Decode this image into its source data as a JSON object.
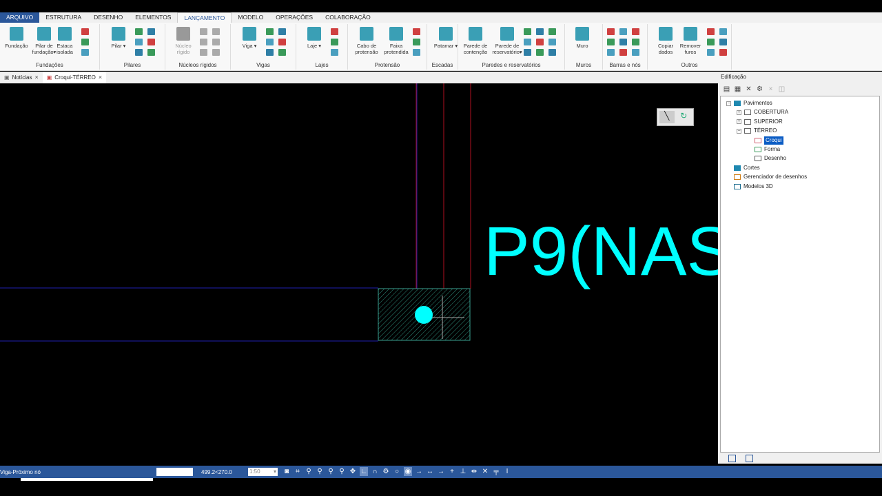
{
  "menu": {
    "tabs": [
      "ARQUIVO",
      "ESTRUTURA",
      "DESENHO",
      "ELEMENTOS",
      "LANÇAMENTO",
      "MODELO",
      "OPERAÇÕES",
      "COLABORAÇÃO"
    ],
    "active": "LANÇAMENTO"
  },
  "ribbon": {
    "groups": [
      {
        "title": "Fundações",
        "buttons": [
          "Fundação",
          "Pilar de fundação▾",
          "Estaca isolada"
        ]
      },
      {
        "title": "Pilares",
        "buttons": [
          "Pilar ▾"
        ]
      },
      {
        "title": "Núcleos rígidos",
        "buttons": [
          "Núcleo rígido"
        ]
      },
      {
        "title": "Vigas",
        "buttons": [
          "Viga ▾"
        ]
      },
      {
        "title": "Lajes",
        "buttons": [
          "Laje ▾"
        ]
      },
      {
        "title": "Protensão",
        "buttons": [
          "Cabo de protensão",
          "Faixa protendida"
        ]
      },
      {
        "title": "Escadas",
        "buttons": [
          "Patamar ▾"
        ]
      },
      {
        "title": "Paredes e reservatórios",
        "buttons": [
          "Parede de contenção",
          "Parede de reservatório▾"
        ]
      },
      {
        "title": "Muros",
        "buttons": [
          "Muro"
        ]
      },
      {
        "title": "Barras e nós",
        "buttons": []
      },
      {
        "title": "Outros",
        "buttons": [
          "Copiar dados",
          "Remover furos"
        ]
      }
    ]
  },
  "doc_tabs": [
    {
      "label": "Notícias",
      "active": false
    },
    {
      "label": "Croqui-TÉRREO",
      "active": true
    }
  ],
  "canvas": {
    "label": "P9(NAS",
    "colors": {
      "text": "#00ffff",
      "column": "#00ffff",
      "hatch": "#2e8b7a",
      "beam": "#1a1aa0",
      "axis": "#b01020"
    }
  },
  "panel": {
    "title": "Edificação",
    "tree": [
      {
        "label": "Pavimentos",
        "level": 0,
        "icon": "folder-icon",
        "expander": "−"
      },
      {
        "label": "COBERTURA",
        "level": 1,
        "icon": "floor-icon",
        "expander": "+"
      },
      {
        "label": "SUPERIOR",
        "level": 1,
        "icon": "floor-icon",
        "expander": "+"
      },
      {
        "label": "TÉRREO",
        "level": 1,
        "icon": "floor-icon",
        "expander": "−"
      },
      {
        "label": "Croqui",
        "level": 2,
        "icon": "sketch-icon",
        "selected": true
      },
      {
        "label": "Forma",
        "level": 2,
        "icon": "form-icon"
      },
      {
        "label": "Desenho",
        "level": 2,
        "icon": "drawing-icon"
      },
      {
        "label": "Cortes",
        "level": 0,
        "icon": "folder-icon"
      },
      {
        "label": "Gerenciador de desenhos",
        "level": 0,
        "icon": "drawing-manager-icon"
      },
      {
        "label": "Modelos 3D",
        "level": 0,
        "icon": "model-3d-icon"
      }
    ]
  },
  "status": {
    "message": "Viga-Próximo nó",
    "coordinates": "499.2<270.0",
    "scale": "1:50"
  }
}
